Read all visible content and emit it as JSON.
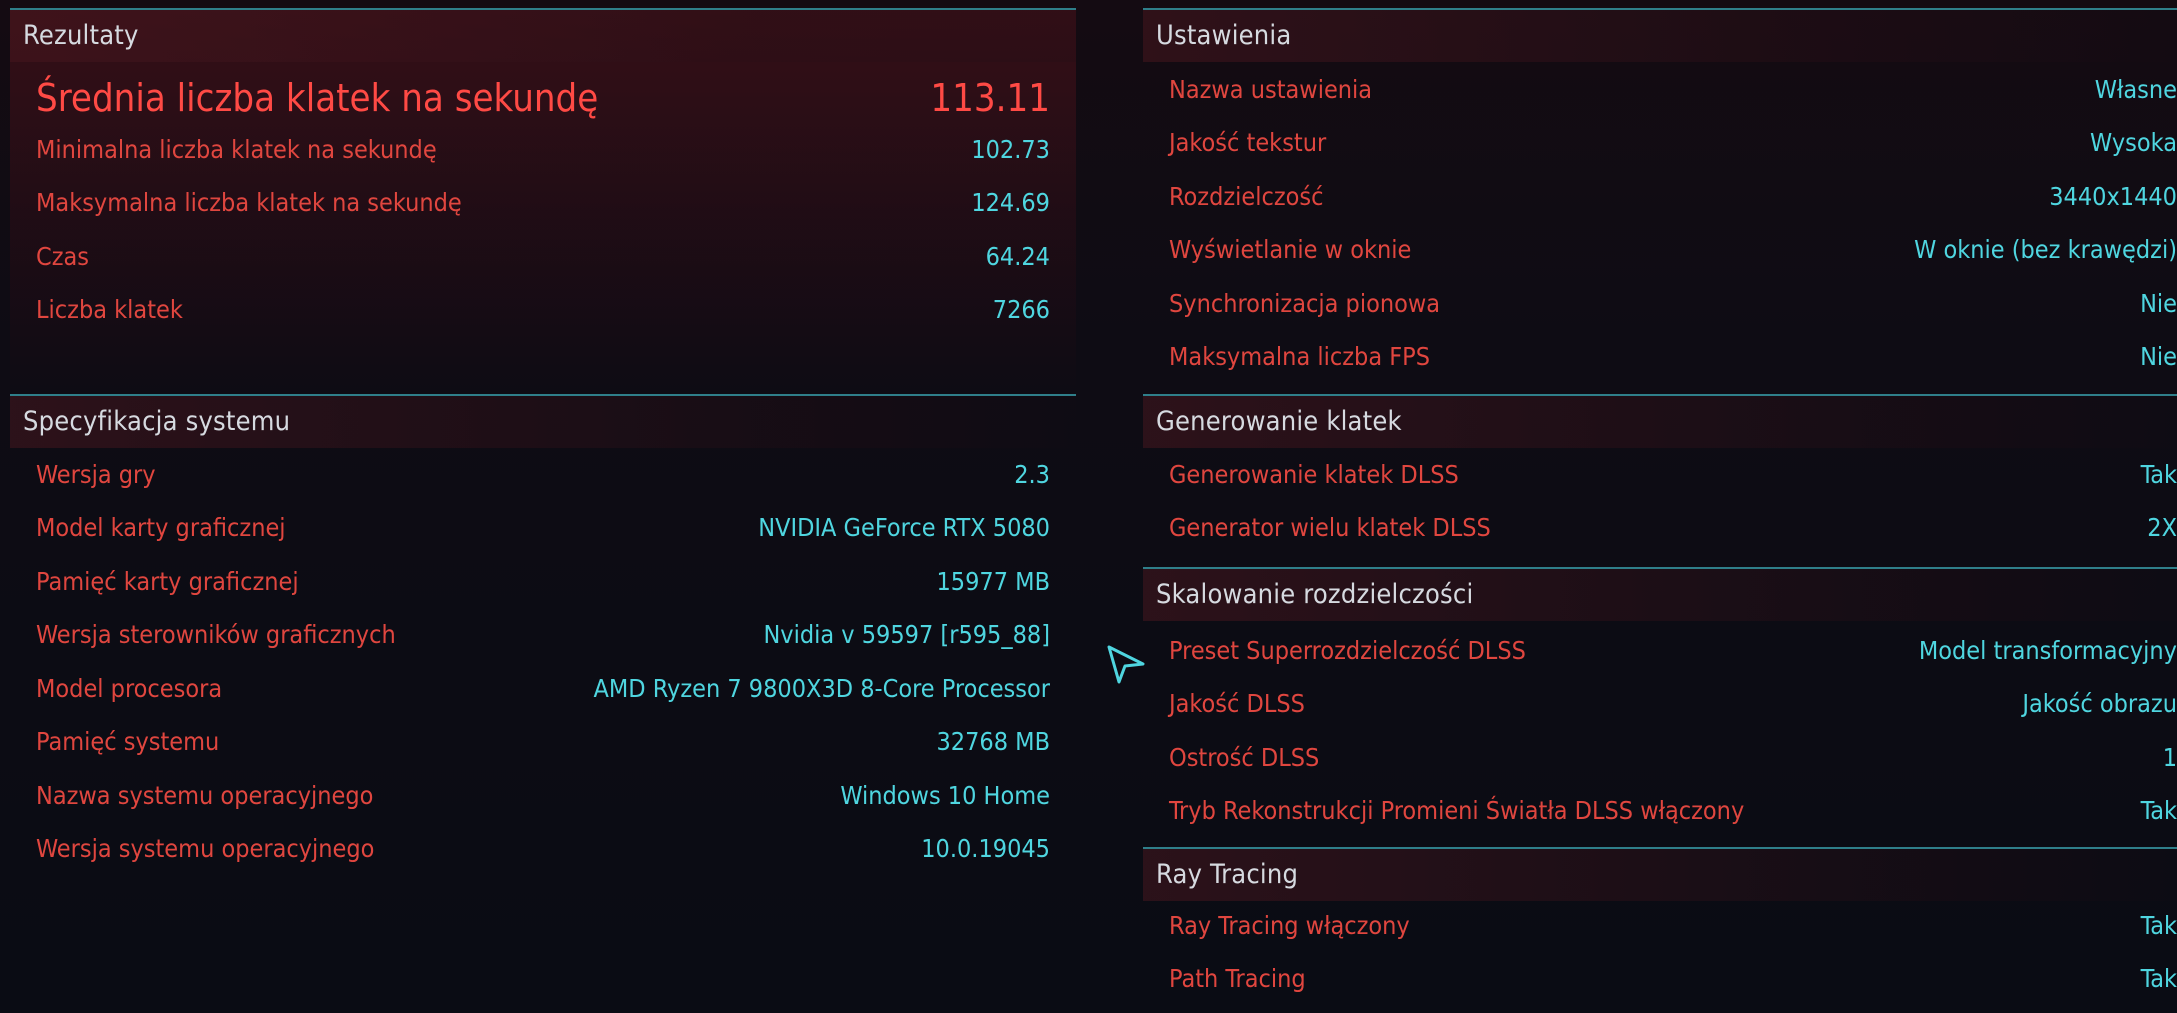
{
  "left": {
    "results": {
      "title": "Rezultaty",
      "rows": [
        {
          "label": "Średnia liczba klatek na sekundę",
          "value": "113.11"
        },
        {
          "label": "Minimalna liczba klatek na sekundę",
          "value": "102.73"
        },
        {
          "label": "Maksymalna liczba klatek na sekundę",
          "value": "124.69"
        },
        {
          "label": "Czas",
          "value": "64.24"
        },
        {
          "label": "Liczba klatek",
          "value": "7266"
        }
      ]
    },
    "system": {
      "title": "Specyfikacja systemu",
      "rows": [
        {
          "label": "Wersja gry",
          "value": "2.3"
        },
        {
          "label": "Model karty graficznej",
          "value": "NVIDIA GeForce RTX 5080"
        },
        {
          "label": "Pamięć karty graficznej",
          "value": "15977 MB"
        },
        {
          "label": "Wersja sterowników graficznych",
          "value": "Nvidia v 59597 [r595_88]"
        },
        {
          "label": "Model procesora",
          "value": "AMD Ryzen 7 9800X3D 8-Core Processor"
        },
        {
          "label": "Pamięć systemu",
          "value": "32768 MB"
        },
        {
          "label": "Nazwa systemu operacyjnego",
          "value": "Windows 10 Home"
        },
        {
          "label": "Wersja systemu operacyjnego",
          "value": "10.0.19045"
        }
      ]
    }
  },
  "right": {
    "settings": {
      "title": "Ustawienia",
      "rows": [
        {
          "label": "Nazwa ustawienia",
          "value": "Własne"
        },
        {
          "label": "Jakość tekstur",
          "value": "Wysoka"
        },
        {
          "label": "Rozdzielczość",
          "value": "3440x1440"
        },
        {
          "label": "Wyświetlanie w oknie",
          "value": "W oknie (bez krawędzi)"
        },
        {
          "label": "Synchronizacja pionowa",
          "value": "Nie"
        },
        {
          "label": "Maksymalna liczba FPS",
          "value": "Nie"
        }
      ]
    },
    "frame_gen": {
      "title": "Generowanie klatek",
      "rows": [
        {
          "label": "Generowanie klatek DLSS",
          "value": "Tak"
        },
        {
          "label": "Generator wielu klatek DLSS",
          "value": "2X"
        }
      ]
    },
    "scaling": {
      "title": "Skalowanie rozdzielczości",
      "rows": [
        {
          "label": "Preset Superrozdzielczość DLSS",
          "value": "Model transformacyjny"
        },
        {
          "label": "Jakość DLSS",
          "value": "Jakość obrazu"
        },
        {
          "label": "Ostrość DLSS",
          "value": "1"
        },
        {
          "label": "Tryb Rekonstrukcji Promieni Światła DLSS włączony",
          "value": "Tak"
        }
      ]
    },
    "ray_tracing": {
      "title": "Ray Tracing",
      "rows": [
        {
          "label": "Ray Tracing włączony",
          "value": "Tak"
        },
        {
          "label": "Path Tracing",
          "value": "Tak"
        }
      ]
    }
  },
  "colors": {
    "label_red": "#e0463f",
    "value_cyan": "#4fd6e0",
    "header_text": "#d6dae0",
    "divider": "#2f7f8a",
    "background": "#0b0d14"
  },
  "icons": {
    "cursor": "cursor-arrow-icon"
  }
}
